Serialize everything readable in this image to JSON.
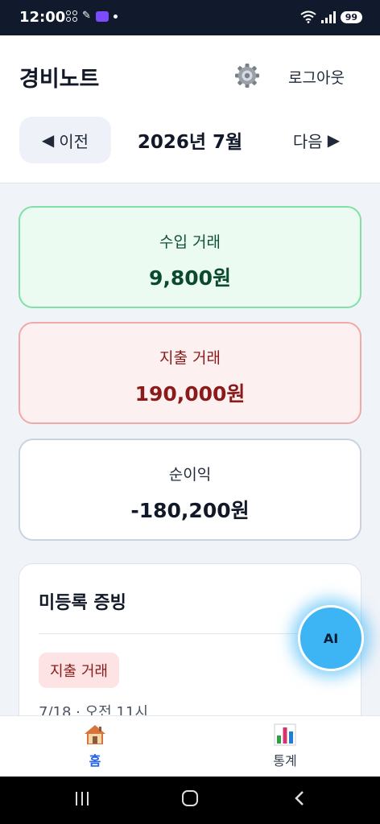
{
  "status_bar": {
    "time": "12:00",
    "battery": "99"
  },
  "header": {
    "title": "경비노트",
    "logout_label": "로그아웃",
    "settings_icon": "gear-icon"
  },
  "month_nav": {
    "prev_label": "이전",
    "current": "2026년 7월",
    "next_label": "다음"
  },
  "summary": {
    "income": {
      "label": "수입 거래",
      "amount": "9,800원"
    },
    "expense": {
      "label": "지출 거래",
      "amount": "190,000원"
    },
    "net": {
      "label": "순이익",
      "amount": "-180,200원"
    }
  },
  "unregistered": {
    "title": "미등록 증빙",
    "item": {
      "tag": "지출 거래",
      "date": "7/18 · 오전 11시"
    }
  },
  "ai_button": {
    "label": "AI"
  },
  "bottom_nav": {
    "items": [
      {
        "label": "홈",
        "icon": "house-icon"
      },
      {
        "label": "통계",
        "icon": "bar-chart-icon"
      }
    ]
  },
  "colors": {
    "accent": "#2563eb",
    "income_bg": "#ebfbf2",
    "expense_bg": "#fdf0f0",
    "ai_button": "#3db5f5"
  }
}
